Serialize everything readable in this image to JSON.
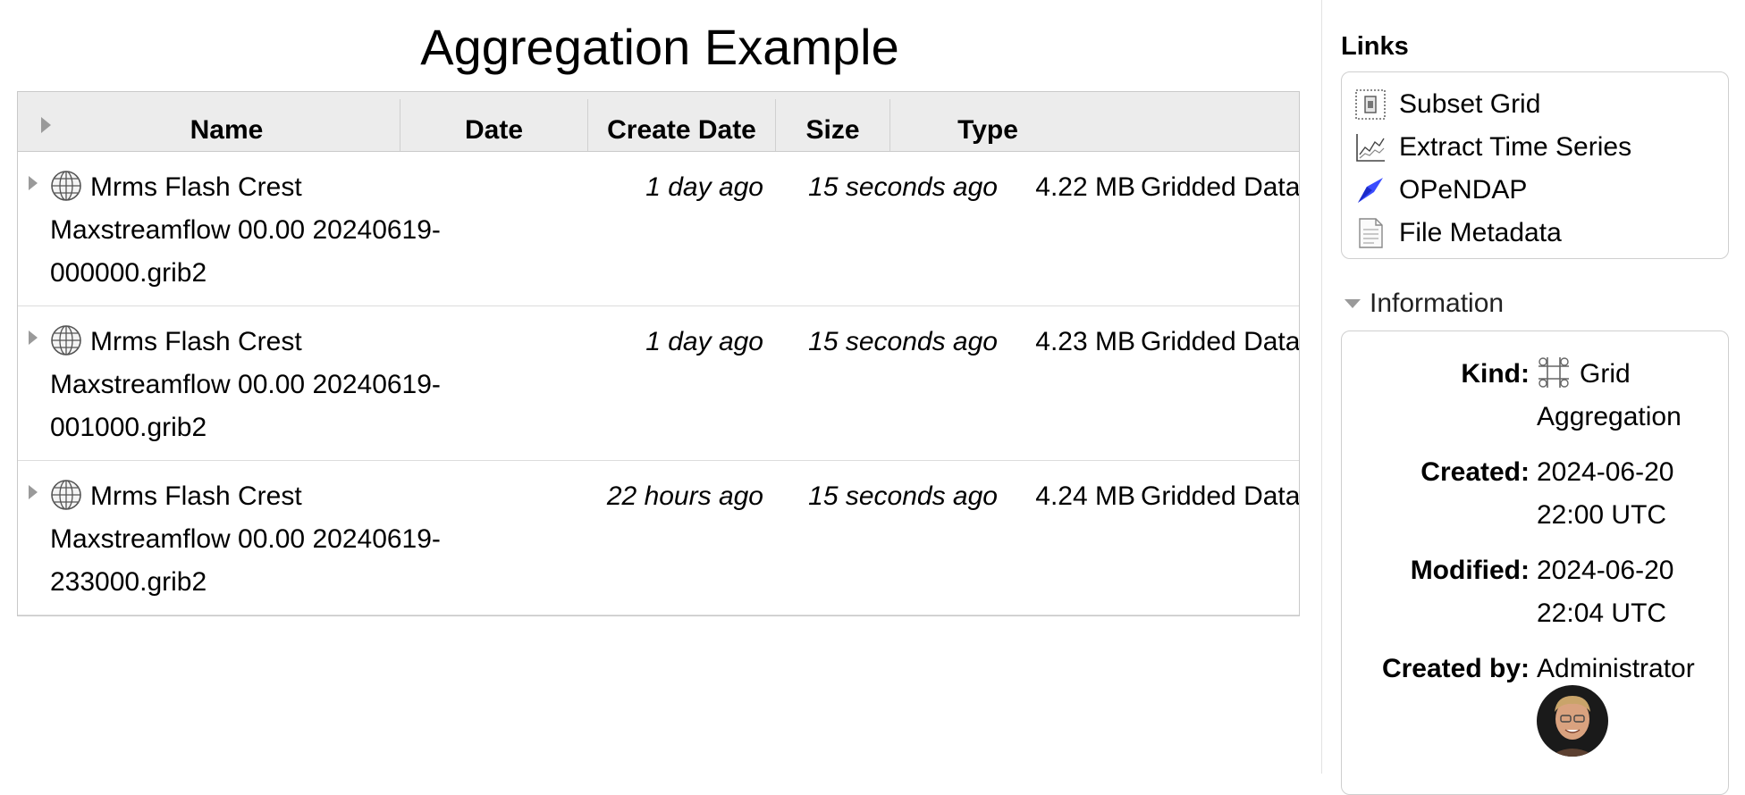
{
  "page_title": "Aggregation Example",
  "table": {
    "columns": [
      "Name",
      "Date",
      "Create Date",
      "Size",
      "Type"
    ],
    "rows": [
      {
        "name": "Mrms Flash Crest Maxstreamflow 00.00 20240619-000000.grib2",
        "date": "1 day ago",
        "create_date": "15 seconds ago",
        "size": "4.22 MB",
        "type": "Gridded Data"
      },
      {
        "name": "Mrms Flash Crest Maxstreamflow 00.00 20240619-001000.grib2",
        "date": "1 day ago",
        "create_date": "15 seconds ago",
        "size": "4.23 MB",
        "type": "Gridded Data"
      },
      {
        "name": "Mrms Flash Crest Maxstreamflow 00.00 20240619-233000.grib2",
        "date": "22 hours ago",
        "create_date": "15 seconds ago",
        "size": "4.24 MB",
        "type": "Gridded Data"
      }
    ],
    "row_icon": "globe-icon"
  },
  "sidebar": {
    "links_title": "Links",
    "links": [
      {
        "label": "Subset Grid",
        "icon": "subset-grid-icon"
      },
      {
        "label": "Extract Time Series",
        "icon": "time-series-icon"
      },
      {
        "label": "OPeNDAP",
        "icon": "opendap-icon"
      },
      {
        "label": "File Metadata",
        "icon": "document-icon"
      }
    ],
    "information": {
      "title": "Information",
      "kind_label": "Kind:",
      "kind_value": "Grid Aggregation",
      "kind_icon": "grid-aggregation-icon",
      "created_label": "Created:",
      "created_value": "2024-06-20 22:00 UTC",
      "modified_label": "Modified:",
      "modified_value": "2024-06-20 22:04 UTC",
      "created_by_label": "Created by:",
      "created_by_value": "Administrator",
      "avatar_icon": "user-avatar"
    }
  },
  "colors": {
    "header_bg": "#ececec",
    "border": "#c9c9c9",
    "opendap_accent": "#3a4cff"
  }
}
